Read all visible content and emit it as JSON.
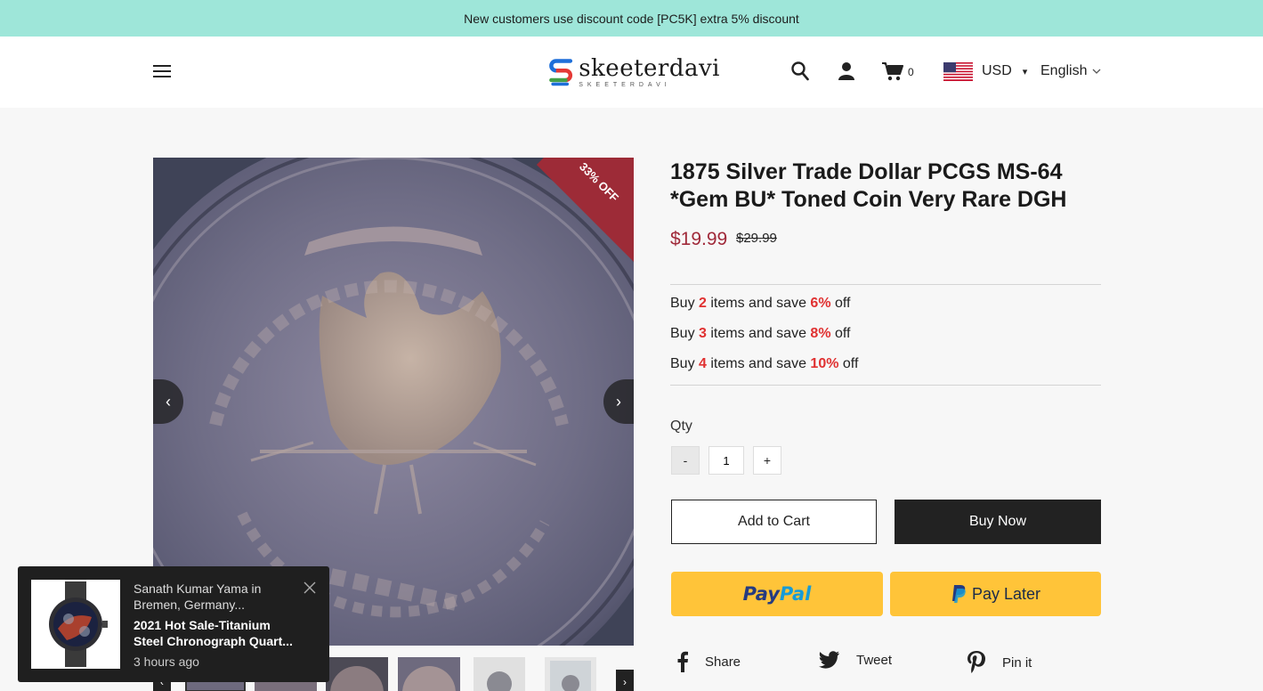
{
  "announcement": "New customers use discount code [PC5K] extra 5% discount",
  "header": {
    "logo_text": "skeeterdavi",
    "logo_subtext": "SKEETERDAVI",
    "cart_count": "0",
    "currency": "USD",
    "language": "English"
  },
  "gallery": {
    "badge": "33% OFF",
    "prev_label": "‹",
    "next_label": "›"
  },
  "product": {
    "title": "1875 Silver Trade Dollar PCGS MS-64 *Gem BU* Toned Coin Very Rare DGH",
    "price": "$19.99",
    "compare_price": "$29.99",
    "tiers": [
      {
        "prefix": "Buy ",
        "qty": "2",
        "mid": " items and save ",
        "pct": "6%",
        "suffix": " off"
      },
      {
        "prefix": "Buy ",
        "qty": "3",
        "mid": " items and save ",
        "pct": "8%",
        "suffix": " off"
      },
      {
        "prefix": "Buy ",
        "qty": "4",
        "mid": " items and save ",
        "pct": "10%",
        "suffix": " off"
      }
    ],
    "qty_label": "Qty",
    "qty_minus": "-",
    "qty_value": "1",
    "qty_plus": "+",
    "add_to_cart": "Add to Cart",
    "buy_now": "Buy Now",
    "paypal_pay": "Pay",
    "paypal_pal": "Pal",
    "pay_later": "Pay Later"
  },
  "share": {
    "facebook": "Share",
    "twitter": "Tweet",
    "pinterest": "Pin it"
  },
  "popup": {
    "who": "Sanath Kumar Yama in Bremen, Germany...",
    "product": "2021 Hot Sale-Titanium Steel Chronograph Quart...",
    "time": "3 hours ago"
  },
  "colors": {
    "announcement_bg": "#9ee6d9",
    "price": "#a02a3a",
    "highlight": "#e03131",
    "paypal_yellow": "#ffc439",
    "badge": "#9d2b37"
  }
}
